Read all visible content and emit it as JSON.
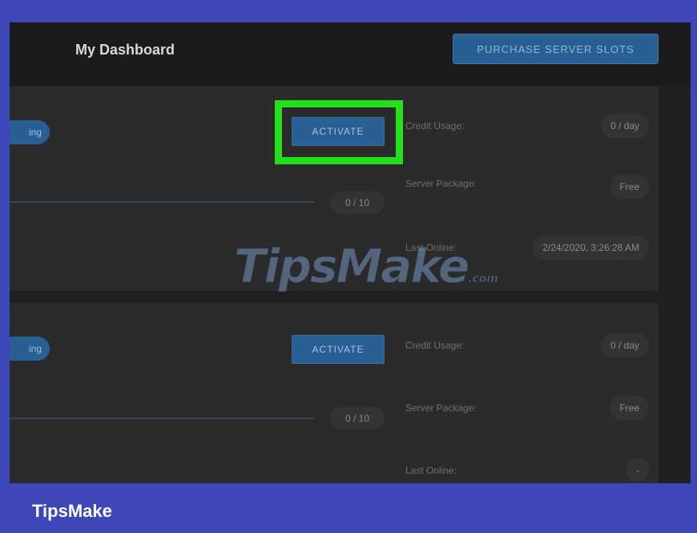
{
  "header": {
    "title": "My Dashboard",
    "purchase_label": "PURCHASE SERVER SLOTS"
  },
  "servers": [
    {
      "status": "ing",
      "activate_label": "ACTIVATE",
      "slots": "0 / 10",
      "credit_label": "Credit Usage:",
      "credit_value": "0 / day",
      "package_label": "Server Package:",
      "package_value": "Free",
      "online_label": "Last Online:",
      "online_value": "2/24/2020, 3:26:28 AM"
    },
    {
      "status": "ing",
      "activate_label": "ACTIVATE",
      "slots": "0 / 10",
      "credit_label": "Credit Usage:",
      "credit_value": "0 / day",
      "package_label": "Server Package:",
      "package_value": "Free",
      "online_label": "Last Online:",
      "online_value": "-"
    }
  ],
  "watermark": {
    "main": "TipsMake",
    "suffix": ".com"
  },
  "brand": "TipsMake",
  "colors": {
    "background": "#3d47b8",
    "accent": "#2a5f93",
    "highlight": "#22e01c"
  }
}
